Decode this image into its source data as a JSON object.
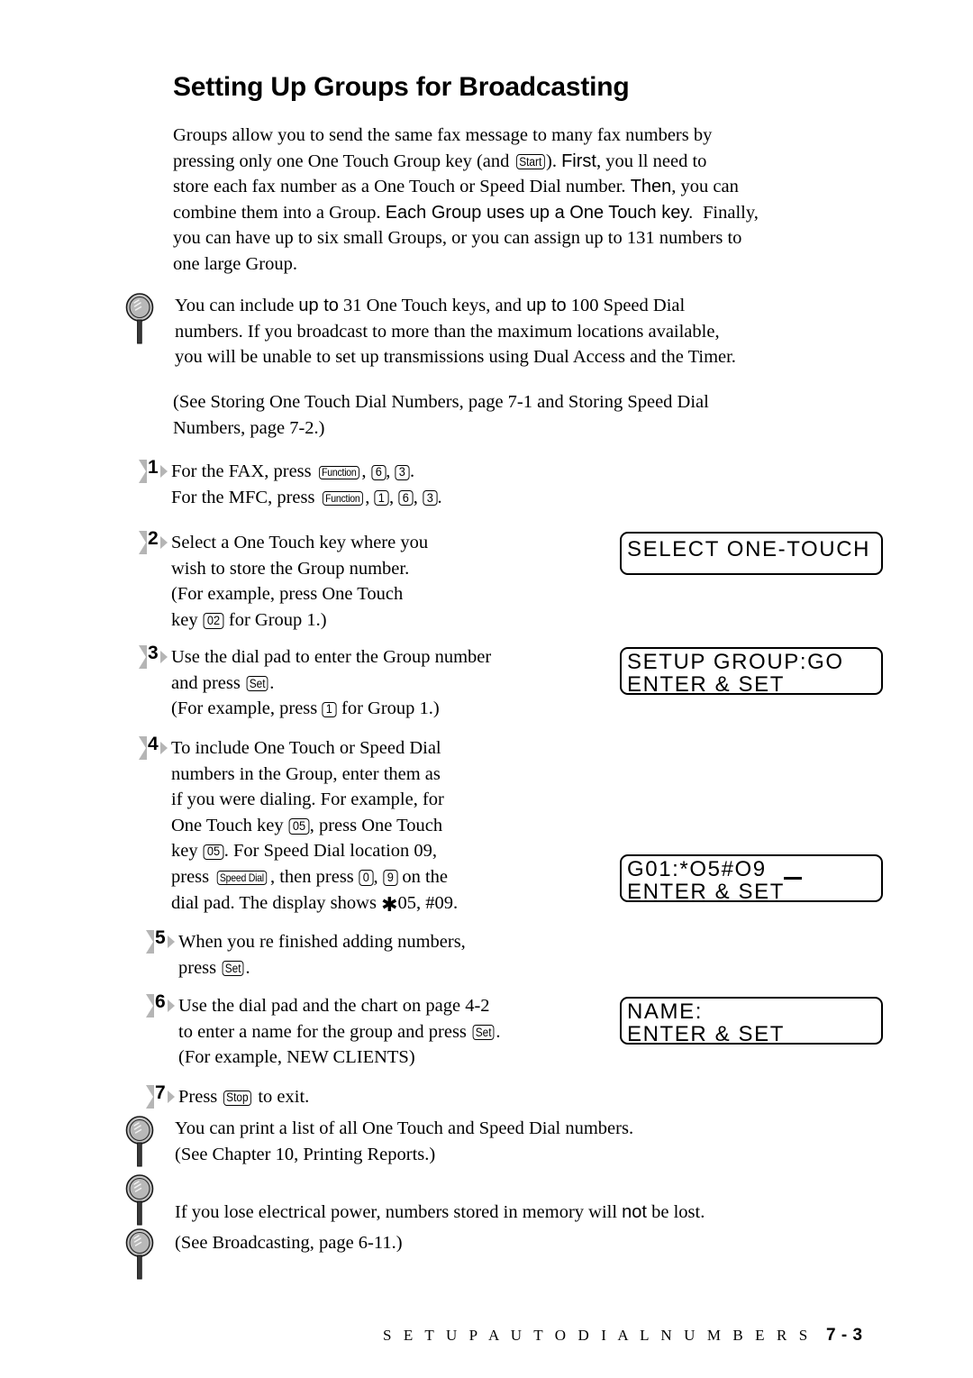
{
  "document": {
    "title": "Setting Up Groups for Broadcasting",
    "footer": {
      "chapter_label": "S E T U P   A U T O   D I A L   N U M B E R S",
      "page_number": "7 - 3"
    }
  },
  "intro": {
    "line1": "Groups allow you to send the same fax message to many fax numbers by",
    "line2a": "pressing only one One Touch Group key (and ",
    "line2_key": "Start",
    "line2b": "). ",
    "line2c": "First",
    "line2d": ", you ll need to",
    "line3a": "store each fax number as a One Touch or Speed Dial number. ",
    "line3b": "Then",
    "line3c": ", you can",
    "line4a": "combine them into a Group. ",
    "line4b": "Each Group uses up a One Touch key.",
    "line4c": "Finally,",
    "line5": "you can have up to six small Groups, or you can assign up to 131 numbers to",
    "line6": "one large Group."
  },
  "note_top": {
    "icon": "magnifier-icon",
    "line1a": "You can include ",
    "line1b": "up to",
    "line1c": " 31 One Touch keys, and ",
    "line1d": "up to",
    "line1e": " 100 Speed Dial",
    "line2": "numbers. If you broadcast to more than the maximum locations available,",
    "line3": "you will be unable to set up transmissions using Dual Access and the Timer."
  },
  "see_reference": {
    "line1": "(See Storing One Touch Dial Numbers, page 7-1 and Storing Speed Dial",
    "line2": "Numbers, page 7-2.)"
  },
  "steps": [
    {
      "number": "1",
      "line1a": "For the FAX, press ",
      "line1_key1": "Function",
      "line1_sep1": ", ",
      "line1_key2": "6",
      "line1_sep2": ", ",
      "line1_key3": "3",
      "line1_end": ".",
      "line2a": "For the MFC, press ",
      "line2_key1": "Function",
      "line2_key2": "1",
      "line2_key3": "6",
      "line2_key4": "3",
      "line2_end": "."
    },
    {
      "number": "2",
      "line1": "Select a One Touch key where you",
      "line2": "wish to store the Group number.",
      "line3": "(For example, press One Touch",
      "line4a": "key ",
      "line4_key": "02",
      "line4b": " for Group 1.)"
    },
    {
      "number": "3",
      "line1": "Use the dial pad to enter the Group number",
      "line2a": "and press ",
      "line2_key": "Set",
      "line2b": ".",
      "line3a": "(For example, press ",
      "line3_key": "1",
      "line3b": " for Group 1.)"
    },
    {
      "number": "4",
      "line1": "To include One Touch or Speed Dial",
      "line2": "numbers in the Group, enter them as",
      "line3": "if you were dialing. For example, for",
      "line4a": "One Touch key ",
      "line4_key": "05",
      "line4b": ", press One Touch",
      "line5a": "key ",
      "line5_key": "05",
      "line5b": ". For Speed Dial location 09,",
      "line6a": "press ",
      "line6_key1": "Speed Dial",
      "line6b": ", then press ",
      "line6_key2": "0",
      "line6c": ", ",
      "line6_key3": "9",
      "line6d": " on the",
      "line7a": "dial pad. The display shows ",
      "line7_ast": "✱",
      "line7b": "05, #09."
    },
    {
      "number": "5",
      "line1": "When you re finished adding numbers,",
      "line2a": "press ",
      "line2_key": "Set",
      "line2b": "."
    },
    {
      "number": "6",
      "line1": "Use the dial pad and the chart on page 4-2",
      "line2a": "to enter a name for the group and press ",
      "line2_key": "Set",
      "line2b": ".",
      "line3": "(For example, NEW CLIENTS)"
    },
    {
      "number": "7",
      "line1a": "Press ",
      "line1_key": "Stop",
      "line1b": " to exit."
    }
  ],
  "lcd_displays": [
    {
      "name": "select-one-touch",
      "line1": "SELECT ONE-TOUCH",
      "line2": ""
    },
    {
      "name": "setup-group-go",
      "line1": "SETUP GROUP:GO",
      "line2": "ENTER & SET"
    },
    {
      "name": "group-entry",
      "line1": "G01:*O5#O9",
      "line2": "ENTER & SET"
    },
    {
      "name": "name-entry",
      "line1": "NAME:",
      "line2": "ENTER & SET"
    }
  ],
  "notes_bottom": [
    {
      "icon": "magnifier-icon",
      "line1": "You can print a list of all One Touch and Speed Dial numbers.",
      "line2": "(See Chapter 10, Printing Reports.)"
    },
    {
      "icon": "magnifier-icon",
      "line1a": "If you lose electrical power, numbers stored in memory will ",
      "line1b": "not",
      "line1c": " be lost.",
      "line2": ""
    },
    {
      "icon": "magnifier-icon",
      "line1": "(See Broadcasting, page 6-11.)",
      "line2": ""
    }
  ],
  "colors": {
    "text": "#000000",
    "background": "#ffffff",
    "icon_lens": "#b8b8b8",
    "icon_outline": "#1a1a1a",
    "marker_wing": "#b5b5b5"
  }
}
